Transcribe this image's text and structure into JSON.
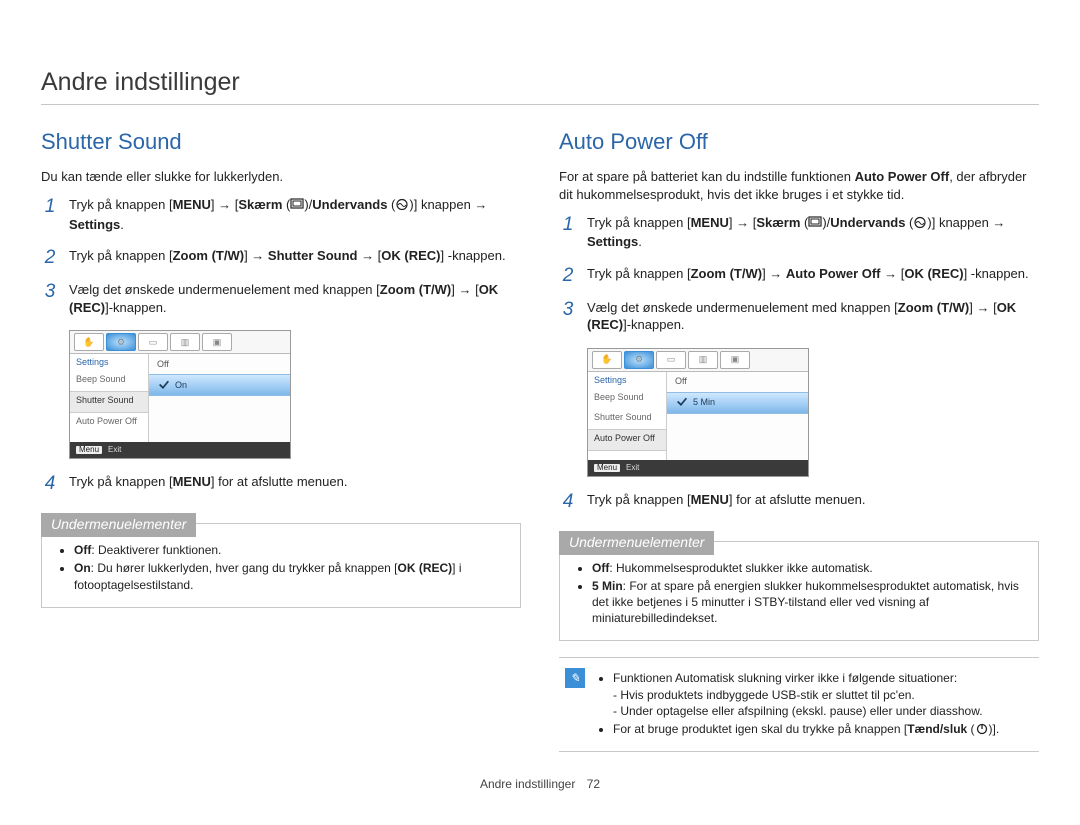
{
  "page": {
    "title": "Andre indstillinger",
    "footer_label": "Andre indstillinger",
    "page_number": "72"
  },
  "left": {
    "heading": "Shutter Sound",
    "intro": "Du kan tænde eller slukke for lukkerlyden.",
    "steps": {
      "s1": {
        "num": "1",
        "prefix": "Tryk på knappen [",
        "menu": "MENU",
        "arrow": "] → [",
        "skarm": "Skærm",
        "mid": " (",
        "mid2": ")/",
        "undervands": "Undervands",
        "mid3": " (",
        "mid4": ")] knappen → ",
        "settings": "Settings",
        "end": "."
      },
      "s2": {
        "num": "2",
        "text_a": "Tryk på knappen [",
        "zoom": "Zoom (T/W)",
        "text_b": "] → ",
        "ss": "Shutter Sound",
        "text_c": " → [",
        "ok": "OK (REC)",
        "text_d": "] -knappen."
      },
      "s3": {
        "num": "3",
        "text_a": "Vælg det ønskede undermenuelement med knappen [",
        "zoom": "Zoom (T/W)",
        "text_b": "] → [",
        "ok": "OK (REC)",
        "text_c": "]-knappen."
      },
      "s4": {
        "num": "4",
        "text_a": "Tryk på knappen [",
        "menu": "MENU",
        "text_b": "] for at afslutte menuen."
      }
    },
    "lcd": {
      "side_title": "Settings",
      "items": [
        "Beep Sound",
        "Shutter Sound",
        "Auto Power Off"
      ],
      "selected_item": "Shutter Sound",
      "options": [
        "Off",
        "On"
      ],
      "selected_option": "On",
      "foot_btn": "Menu",
      "foot_text": "Exit"
    },
    "submenu": {
      "label": "Undermenuelementer",
      "items": [
        {
          "term": "Off",
          "desc": ": Deaktiverer funktionen."
        },
        {
          "term": "On",
          "desc": ": Du hører lukkerlyden, hver gang du trykker på knappen [",
          "ok": "OK (REC)",
          "desc2": "] i fotooptagelsestilstand."
        }
      ]
    }
  },
  "right": {
    "heading": "Auto Power Off",
    "intro_a": "For at spare på batteriet kan du indstille funktionen ",
    "intro_bold": "Auto Power Off",
    "intro_b": ", der afbryder dit hukommelsesprodukt, hvis det ikke bruges i et stykke tid.",
    "steps": {
      "s1": {
        "num": "1",
        "prefix": "Tryk på knappen [",
        "menu": "MENU",
        "arrow": "] → [",
        "skarm": "Skærm",
        "mid": " (",
        "mid2": ")/",
        "undervands": "Undervands",
        "mid3": " (",
        "mid4": ")] knappen → ",
        "settings": "Settings",
        "end": "."
      },
      "s2": {
        "num": "2",
        "text_a": "Tryk på knappen [",
        "zoom": "Zoom (T/W)",
        "text_b": "] → ",
        "apo": "Auto Power Off",
        "text_c": " → [",
        "ok": "OK (REC)",
        "text_d": "] -knappen."
      },
      "s3": {
        "num": "3",
        "text_a": "Vælg det ønskede undermenuelement med knappen [",
        "zoom": "Zoom (T/W)",
        "text_b": "] → [",
        "ok": "OK (REC)",
        "text_c": "]-knappen."
      },
      "s4": {
        "num": "4",
        "text_a": "Tryk på knappen [",
        "menu": "MENU",
        "text_b": "] for at afslutte menuen."
      }
    },
    "lcd": {
      "side_title": "Settings",
      "items": [
        "Beep Sound",
        "Shutter Sound",
        "Auto Power Off"
      ],
      "selected_item": "Auto Power Off",
      "options": [
        "Off",
        "5 Min"
      ],
      "selected_option": "5 Min",
      "foot_btn": "Menu",
      "foot_text": "Exit"
    },
    "submenu": {
      "label": "Undermenuelementer",
      "items": [
        {
          "term": "Off",
          "desc": ": Hukommelsesproduktet slukker ikke automatisk."
        },
        {
          "term": "5 Min",
          "desc": ": For at spare på energien slukker hukommelsesproduktet automatisk, hvis det ikke betjenes i 5 minutter i STBY-tilstand eller ved visning af miniaturebilledindekset."
        }
      ]
    },
    "note": {
      "bullets": [
        "Funktionen Automatisk slukning virker ikke i følgende situationer:",
        "For at bruge produktet igen skal du trykke på knappen ["
      ],
      "sub_a": "- Hvis produktets indbyggede USB-stik er sluttet til pc'en.",
      "sub_b": "- Under optagelse eller afspilning (ekskl. pause) eller under diasshow.",
      "power_label": "Tænd/sluk",
      "b2_end": " ()]."
    }
  }
}
